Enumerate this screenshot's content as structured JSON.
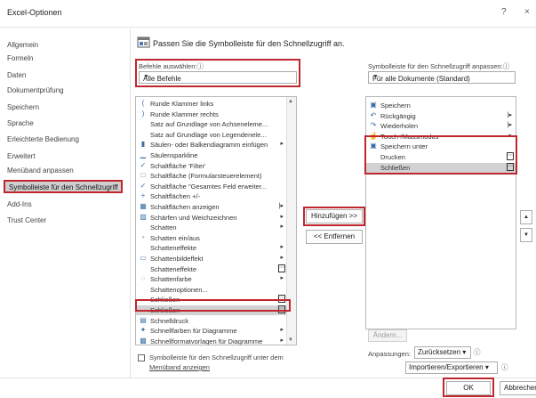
{
  "window": {
    "title": "Excel-Optionen",
    "help": "?",
    "close": "×"
  },
  "nav": {
    "items": [
      "Allgemein",
      "Formeln",
      "Daten",
      "Dokumentprüfung",
      "Speichern",
      "Sprache",
      "Erleichterte Bedienung",
      "Erweitert",
      "Menüband anpassen",
      "Symbolleiste für den Schnellzugriff",
      "Add-Ins",
      "Trust Center"
    ],
    "selected_index": 9
  },
  "heading": "Passen Sie die Symbolleiste für den Schnellzugriff an.",
  "commands": {
    "label": "Befehle auswählen:",
    "label_info": "ⓘ",
    "selected": "Alle Befehle",
    "items": [
      {
        "icon": "(",
        "text": "Runde Klammer links"
      },
      {
        "icon": ")",
        "text": "Runde Klammer rechts"
      },
      {
        "icon": "",
        "text": "Satz auf Grundlage von Achseneleme..."
      },
      {
        "icon": "",
        "text": "Satz auf Grundlage von Legendenele..."
      },
      {
        "icon": "▮",
        "text": "Säulen- oder Balkendiagramm einfügen",
        "arrow": "▸"
      },
      {
        "icon": "▁",
        "text": "Säulensparkline"
      },
      {
        "icon": "✓",
        "text": "Schaltfläche 'Filter'"
      },
      {
        "icon": "□",
        "text": "Schaltfläche (Formularsteuerelement)"
      },
      {
        "icon": "✓",
        "text": "Schaltfläche \"Gesamtes Feld erweiter..."
      },
      {
        "icon": "+",
        "text": "Schaltflächen +/-"
      },
      {
        "icon": "▦",
        "text": "Schaltflächen anzeigen",
        "arrow": "|▸"
      },
      {
        "icon": "▨",
        "text": "Schärfen und Weichzeichnen",
        "arrow": "▸"
      },
      {
        "icon": "",
        "text": "Schatten",
        "arrow": "▸"
      },
      {
        "icon": "▫",
        "text": "Schatten ein/aus"
      },
      {
        "icon": "",
        "text": "Schatteneffekte",
        "arrow": "▸"
      },
      {
        "icon": "▭",
        "text": "Schattenbildeffekt",
        "arrow": "▸"
      },
      {
        "icon": "",
        "text": "Schatteneffekte",
        "box": "⋯"
      },
      {
        "icon": "◌",
        "text": "Schattenfarbe",
        "arrow": "▸"
      },
      {
        "icon": "",
        "text": "Schattenoptionen..."
      },
      {
        "icon": "",
        "text": "Schließen",
        "box": "⋯"
      },
      {
        "icon": "",
        "text": "Schließen",
        "box": "⋯",
        "selected": true
      },
      {
        "icon": "▤",
        "text": "Schnelldruck"
      },
      {
        "icon": "✦",
        "text": "Schnellfarben für Diagramme",
        "arrow": "▸"
      },
      {
        "icon": "▩",
        "text": "Schnellformatvorlagen für Diagramme",
        "arrow": "▸"
      }
    ]
  },
  "qat": {
    "label": "Symbolleiste für den Schnellzugriff anpassen:",
    "label_info": "ⓘ",
    "selected": "Für alle Dokumente (Standard)",
    "items": [
      {
        "icon": "▣",
        "text": "Speichern"
      },
      {
        "icon": "↶",
        "text": "Rückgängig",
        "arrow": "|▸"
      },
      {
        "icon": "↷",
        "text": "Wiederholen",
        "arrow": "|▸"
      },
      {
        "icon": "☝",
        "text": "Touch-/Mausmodus",
        "arrow": "▸"
      },
      {
        "icon": "▣",
        "text": "Speichern unter"
      },
      {
        "icon": "",
        "text": "Drucken",
        "box": "⋯"
      },
      {
        "icon": "",
        "text": "Schließen",
        "box": "⋯",
        "selected": true
      }
    ]
  },
  "buttons": {
    "add": "Hinzufügen >>",
    "remove": "<< Entfernen",
    "modify": "Ändern...",
    "reset": "Zurücksetzen ▾",
    "import_export": "Importieren/Exportieren ▾",
    "ok": "OK",
    "cancel": "Abbrechen"
  },
  "customizations_label": "Anpassungen:",
  "info_glyph": "ⓘ",
  "show_below": {
    "line1": "Symbolleiste für den Schnellzugriff unter dem",
    "line2": "Menüband anzeigen"
  },
  "up_arrow": "▲",
  "down_arrow": "▼",
  "colors": {
    "highlight": "#c0262d",
    "selected_row": "#d2d2d2"
  }
}
